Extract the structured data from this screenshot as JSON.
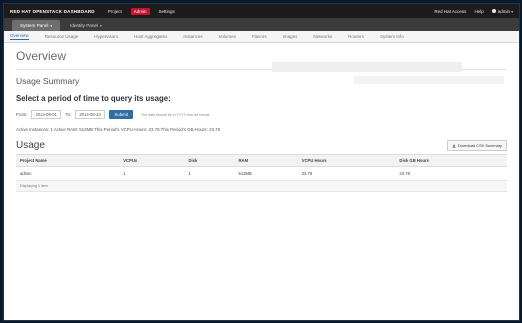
{
  "topbar": {
    "brand": "RED HAT OPENSTACK DASHBOARD",
    "nav": [
      "Project",
      "Admin",
      "Settings"
    ],
    "active_nav_index": 1,
    "right": [
      "Red Hat Access",
      "Help",
      "admin"
    ]
  },
  "panels": [
    {
      "label": "System Panel"
    },
    {
      "label": "Identity Panel"
    }
  ],
  "subnav": [
    "Overview",
    "Resource Usage",
    "Hypervisors",
    "Host Aggregates",
    "Instances",
    "Volumes",
    "Flavors",
    "Images",
    "Networks",
    "Routers",
    "System Info"
  ],
  "page": {
    "title": "Overview",
    "usage_summary": "Usage Summary",
    "select_period": "Select a period of time to query its usage:",
    "from_label": "From:",
    "from_value": "2014-08-01",
    "to_label": "To:",
    "to_value": "2014-08-13",
    "submit": "Submit",
    "hint": "The date should be in YYYY-mm-dd format.",
    "active_line": "Active Instances: 1 Active RAM: 512MB This Period's VCPU-Hours: 23.78 This Period's GB-Hours: 23.78",
    "usage_title": "Usage",
    "csv_button": "Download CSV Summary"
  },
  "table": {
    "headers": [
      "Project Name",
      "VCPUs",
      "Disk",
      "RAM",
      "VCPU Hours",
      "Disk GB Hours"
    ],
    "rows": [
      [
        "admin",
        "1",
        "1",
        "512MB",
        "23.78",
        "23.78"
      ]
    ],
    "footer": "Displaying 1 item"
  },
  "colors": {
    "accent": "#2f6da4",
    "active_nav": "#c4122f",
    "topbar": "#1c1c1c"
  }
}
